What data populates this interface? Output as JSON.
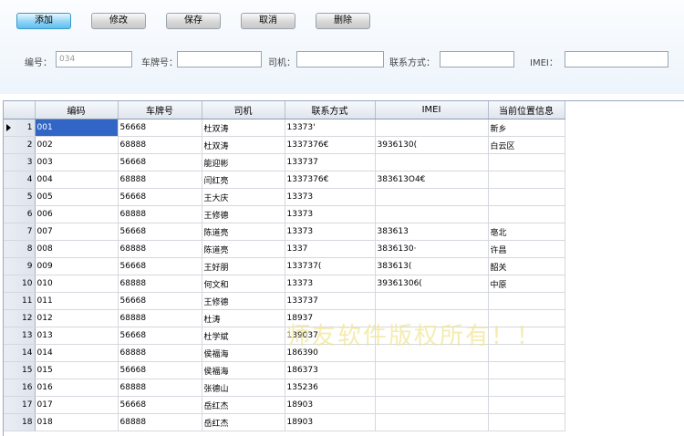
{
  "toolbar": {
    "add": "添加",
    "edit": "修改",
    "save": "保存",
    "cancel": "取消",
    "delete": "删除"
  },
  "form": {
    "code_label": "编号：",
    "code_value": "034",
    "plate_label": "车牌号：",
    "plate_value": "",
    "driver_label": "司机：",
    "driver_value": "",
    "contact_label": "联系方式：",
    "contact_value": "",
    "imei_label": "IMEI：",
    "imei_value": ""
  },
  "grid": {
    "columns": [
      "编码",
      "车牌号",
      "司机",
      "联系方式",
      "IMEI",
      "当前位置信息"
    ],
    "rows": [
      {
        "no": "1",
        "code": "001",
        "plate": "56668",
        "driver": "杜双涛",
        "contact": "13373'",
        "imei": "",
        "location": "新乡"
      },
      {
        "no": "2",
        "code": "002",
        "plate": "68888",
        "driver": "杜双涛",
        "contact": "1337376€",
        "imei": "3936130(",
        "location": "白云区"
      },
      {
        "no": "3",
        "code": "003",
        "plate": "56668",
        "driver": "能迎彬",
        "contact": "133737",
        "imei": "",
        "location": ""
      },
      {
        "no": "4",
        "code": "004",
        "plate": "68888",
        "driver": "闫红亮",
        "contact": "1337376€",
        "imei": "383613O4€",
        "location": ""
      },
      {
        "no": "5",
        "code": "005",
        "plate": "56668",
        "driver": "王大庆",
        "contact": "13373",
        "imei": "",
        "location": ""
      },
      {
        "no": "6",
        "code": "006",
        "plate": "68888",
        "driver": "王修德",
        "contact": "13373",
        "imei": "",
        "location": ""
      },
      {
        "no": "7",
        "code": "007",
        "plate": "56668",
        "driver": "陈道亮",
        "contact": "13373",
        "imei": "383613",
        "location": "亳北"
      },
      {
        "no": "8",
        "code": "008",
        "plate": "68888",
        "driver": "陈道亮",
        "contact": "1337",
        "imei": "3836130·",
        "location": "许昌"
      },
      {
        "no": "9",
        "code": "009",
        "plate": "56668",
        "driver": "王好朋",
        "contact": "133737(",
        "imei": "383613(",
        "location": "韶关"
      },
      {
        "no": "10",
        "code": "010",
        "plate": "68888",
        "driver": "何文和",
        "contact": "13373",
        "imei": "39361306(",
        "location": "中原"
      },
      {
        "no": "11",
        "code": "011",
        "plate": "56668",
        "driver": "王修德",
        "contact": "133737",
        "imei": "",
        "location": ""
      },
      {
        "no": "12",
        "code": "012",
        "plate": "68888",
        "driver": "杜涛",
        "contact": "18937",
        "imei": "",
        "location": ""
      },
      {
        "no": "13",
        "code": "013",
        "plate": "56668",
        "driver": "杜学斌",
        "contact": "139037",
        "imei": "",
        "location": ""
      },
      {
        "no": "14",
        "code": "014",
        "plate": "68888",
        "driver": "侯福海",
        "contact": "186390",
        "imei": "",
        "location": ""
      },
      {
        "no": "15",
        "code": "015",
        "plate": "56668",
        "driver": "侯福海",
        "contact": "186373",
        "imei": "",
        "location": ""
      },
      {
        "no": "16",
        "code": "016",
        "plate": "68888",
        "driver": "张德山",
        "contact": "135236",
        "imei": "",
        "location": ""
      },
      {
        "no": "17",
        "code": "017",
        "plate": "56668",
        "driver": "岳红杰",
        "contact": "18903",
        "imei": "",
        "location": ""
      },
      {
        "no": "18",
        "code": "018",
        "plate": "68888",
        "driver": "岳红杰",
        "contact": "18903",
        "imei": "",
        "location": ""
      }
    ]
  },
  "watermark": "师友软件版权所有！！",
  "colors": {
    "selected_cell": "#3166c6",
    "active_button": "#5ebfee",
    "watermark": "#f0e696"
  }
}
